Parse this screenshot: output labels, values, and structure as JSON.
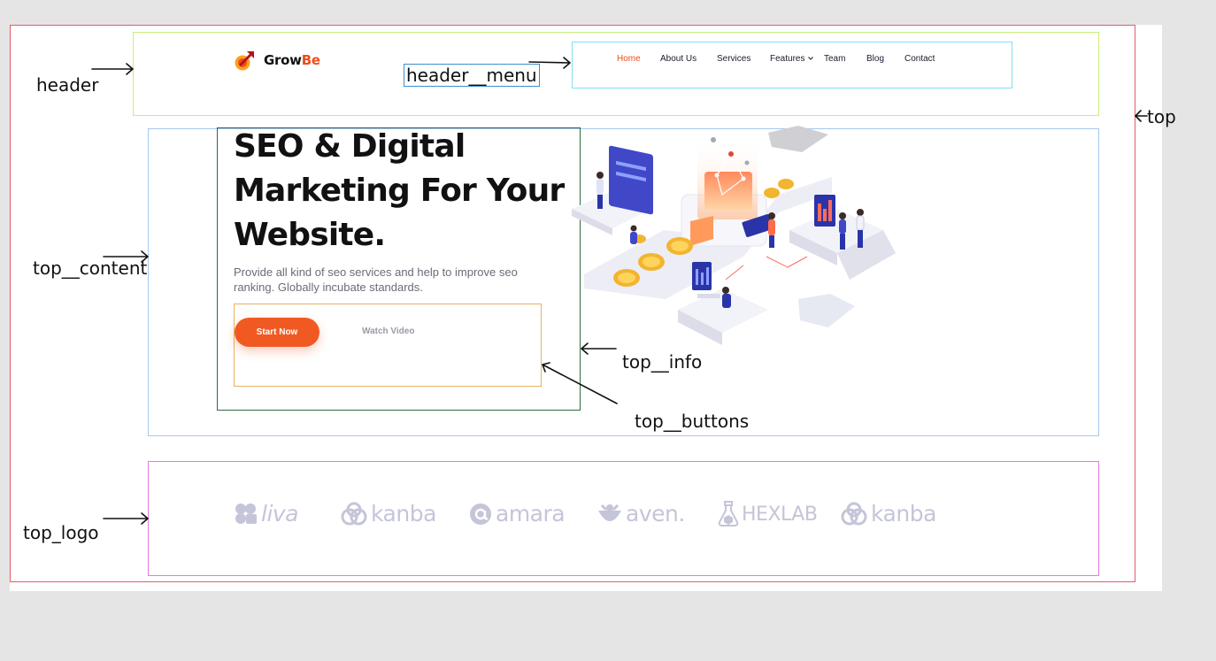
{
  "annotations": {
    "header": "header",
    "header_menu": "header__menu",
    "top": "top",
    "top_content": "top__content",
    "top_info": "top__info",
    "top_buttons": "top__buttons",
    "top_logo": "top_logo"
  },
  "header": {
    "logo_primary": "Grow",
    "logo_accent": "Be",
    "logo_icon": "rocket-arrow-icon"
  },
  "menu": {
    "items": [
      {
        "label": "Home",
        "active": true
      },
      {
        "label": "About Us"
      },
      {
        "label": "Services"
      },
      {
        "label": "Features",
        "dropdown": true
      },
      {
        "label": "Team"
      },
      {
        "label": "Blog"
      },
      {
        "label": "Contact"
      }
    ]
  },
  "hero": {
    "title_line1": "SEO & Digital",
    "title_line2": "Marketing For Your",
    "title_line3": "Website.",
    "description": "Provide all kind of seo services and help to improve seo ranking. Globally incubate standards.",
    "start_button": "Start Now",
    "watch_button": "Watch Video"
  },
  "brands": [
    {
      "name": "liva",
      "icon": "flower-icon"
    },
    {
      "name": "kanba",
      "icon": "infinity-knot-icon"
    },
    {
      "name": "amara",
      "icon": "at-sign-icon"
    },
    {
      "name": "aven.",
      "icon": "bowl-icon"
    },
    {
      "name": "HEXLAB",
      "icon": "flask-icon"
    },
    {
      "name": "kanba",
      "icon": "infinity-knot-icon"
    }
  ],
  "colors": {
    "brand_orange": "#f05a22",
    "menu_active": "#ee4c1a",
    "brand_logo_gray": "#c4c5d8",
    "box_top": "#e65a6a",
    "box_header": "#c9ee7a",
    "box_menu": "#82dff0",
    "box_content": "#a8c6ef",
    "box_info": "#2f6b3d",
    "box_buttons": "#e9b061",
    "box_logo": "#e47ae0"
  }
}
